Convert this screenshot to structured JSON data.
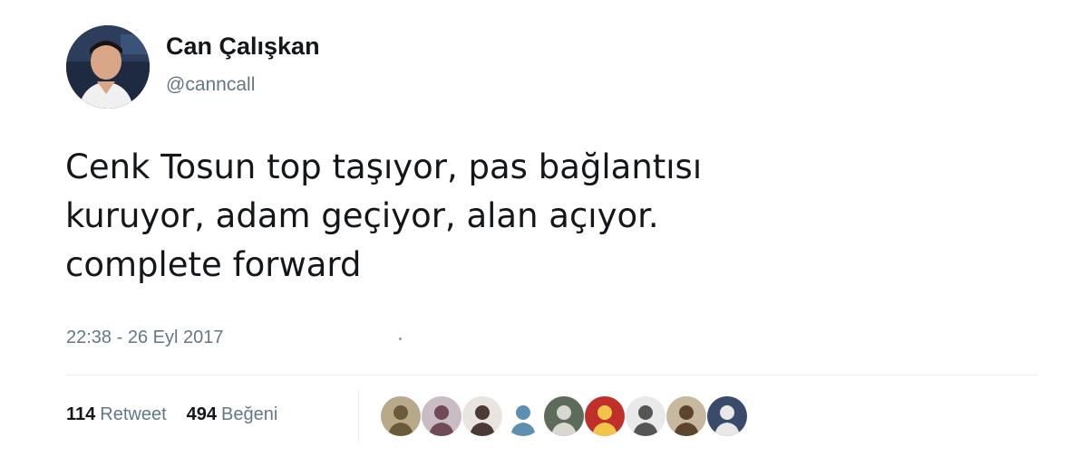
{
  "user": {
    "display_name": "Can Çalışkan",
    "handle": "@canncall"
  },
  "tweet": {
    "text": "Cenk Tosun top taşıyor, pas bağlantısı\nkuruyor, adam geçiyor, alan açıyor.\ncomplete forward",
    "timestamp": "22:38 - 26 Eyl 2017"
  },
  "stats": {
    "retweets_count": "114",
    "retweets_label": "Retweet",
    "likes_count": "494",
    "likes_label": "Beğeni"
  },
  "likers": [
    {
      "icon": "user-avatar",
      "bg": "#b8a98a",
      "fg": "#6b5a3a"
    },
    {
      "icon": "user-avatar",
      "bg": "#c9bcc4",
      "fg": "#6e4b55"
    },
    {
      "icon": "user-avatar",
      "bg": "#e9e4df",
      "fg": "#4a3a35"
    },
    {
      "icon": "user-avatar",
      "bg": "#ffffff",
      "fg": "#5e8fb0"
    },
    {
      "icon": "user-avatar",
      "bg": "#5e6b5a",
      "fg": "#d8d8d0"
    },
    {
      "icon": "user-avatar",
      "bg": "#c0302a",
      "fg": "#f3c44a"
    },
    {
      "icon": "user-avatar",
      "bg": "#e9e9e9",
      "fg": "#555555"
    },
    {
      "icon": "user-avatar",
      "bg": "#c9b8a0",
      "fg": "#5c4430"
    },
    {
      "icon": "user-avatar",
      "bg": "#3a4a6a",
      "fg": "#e8e8e8"
    }
  ],
  "colors": {
    "text_primary": "#14171a",
    "text_secondary": "#657786",
    "divider": "#e6ecf0"
  }
}
